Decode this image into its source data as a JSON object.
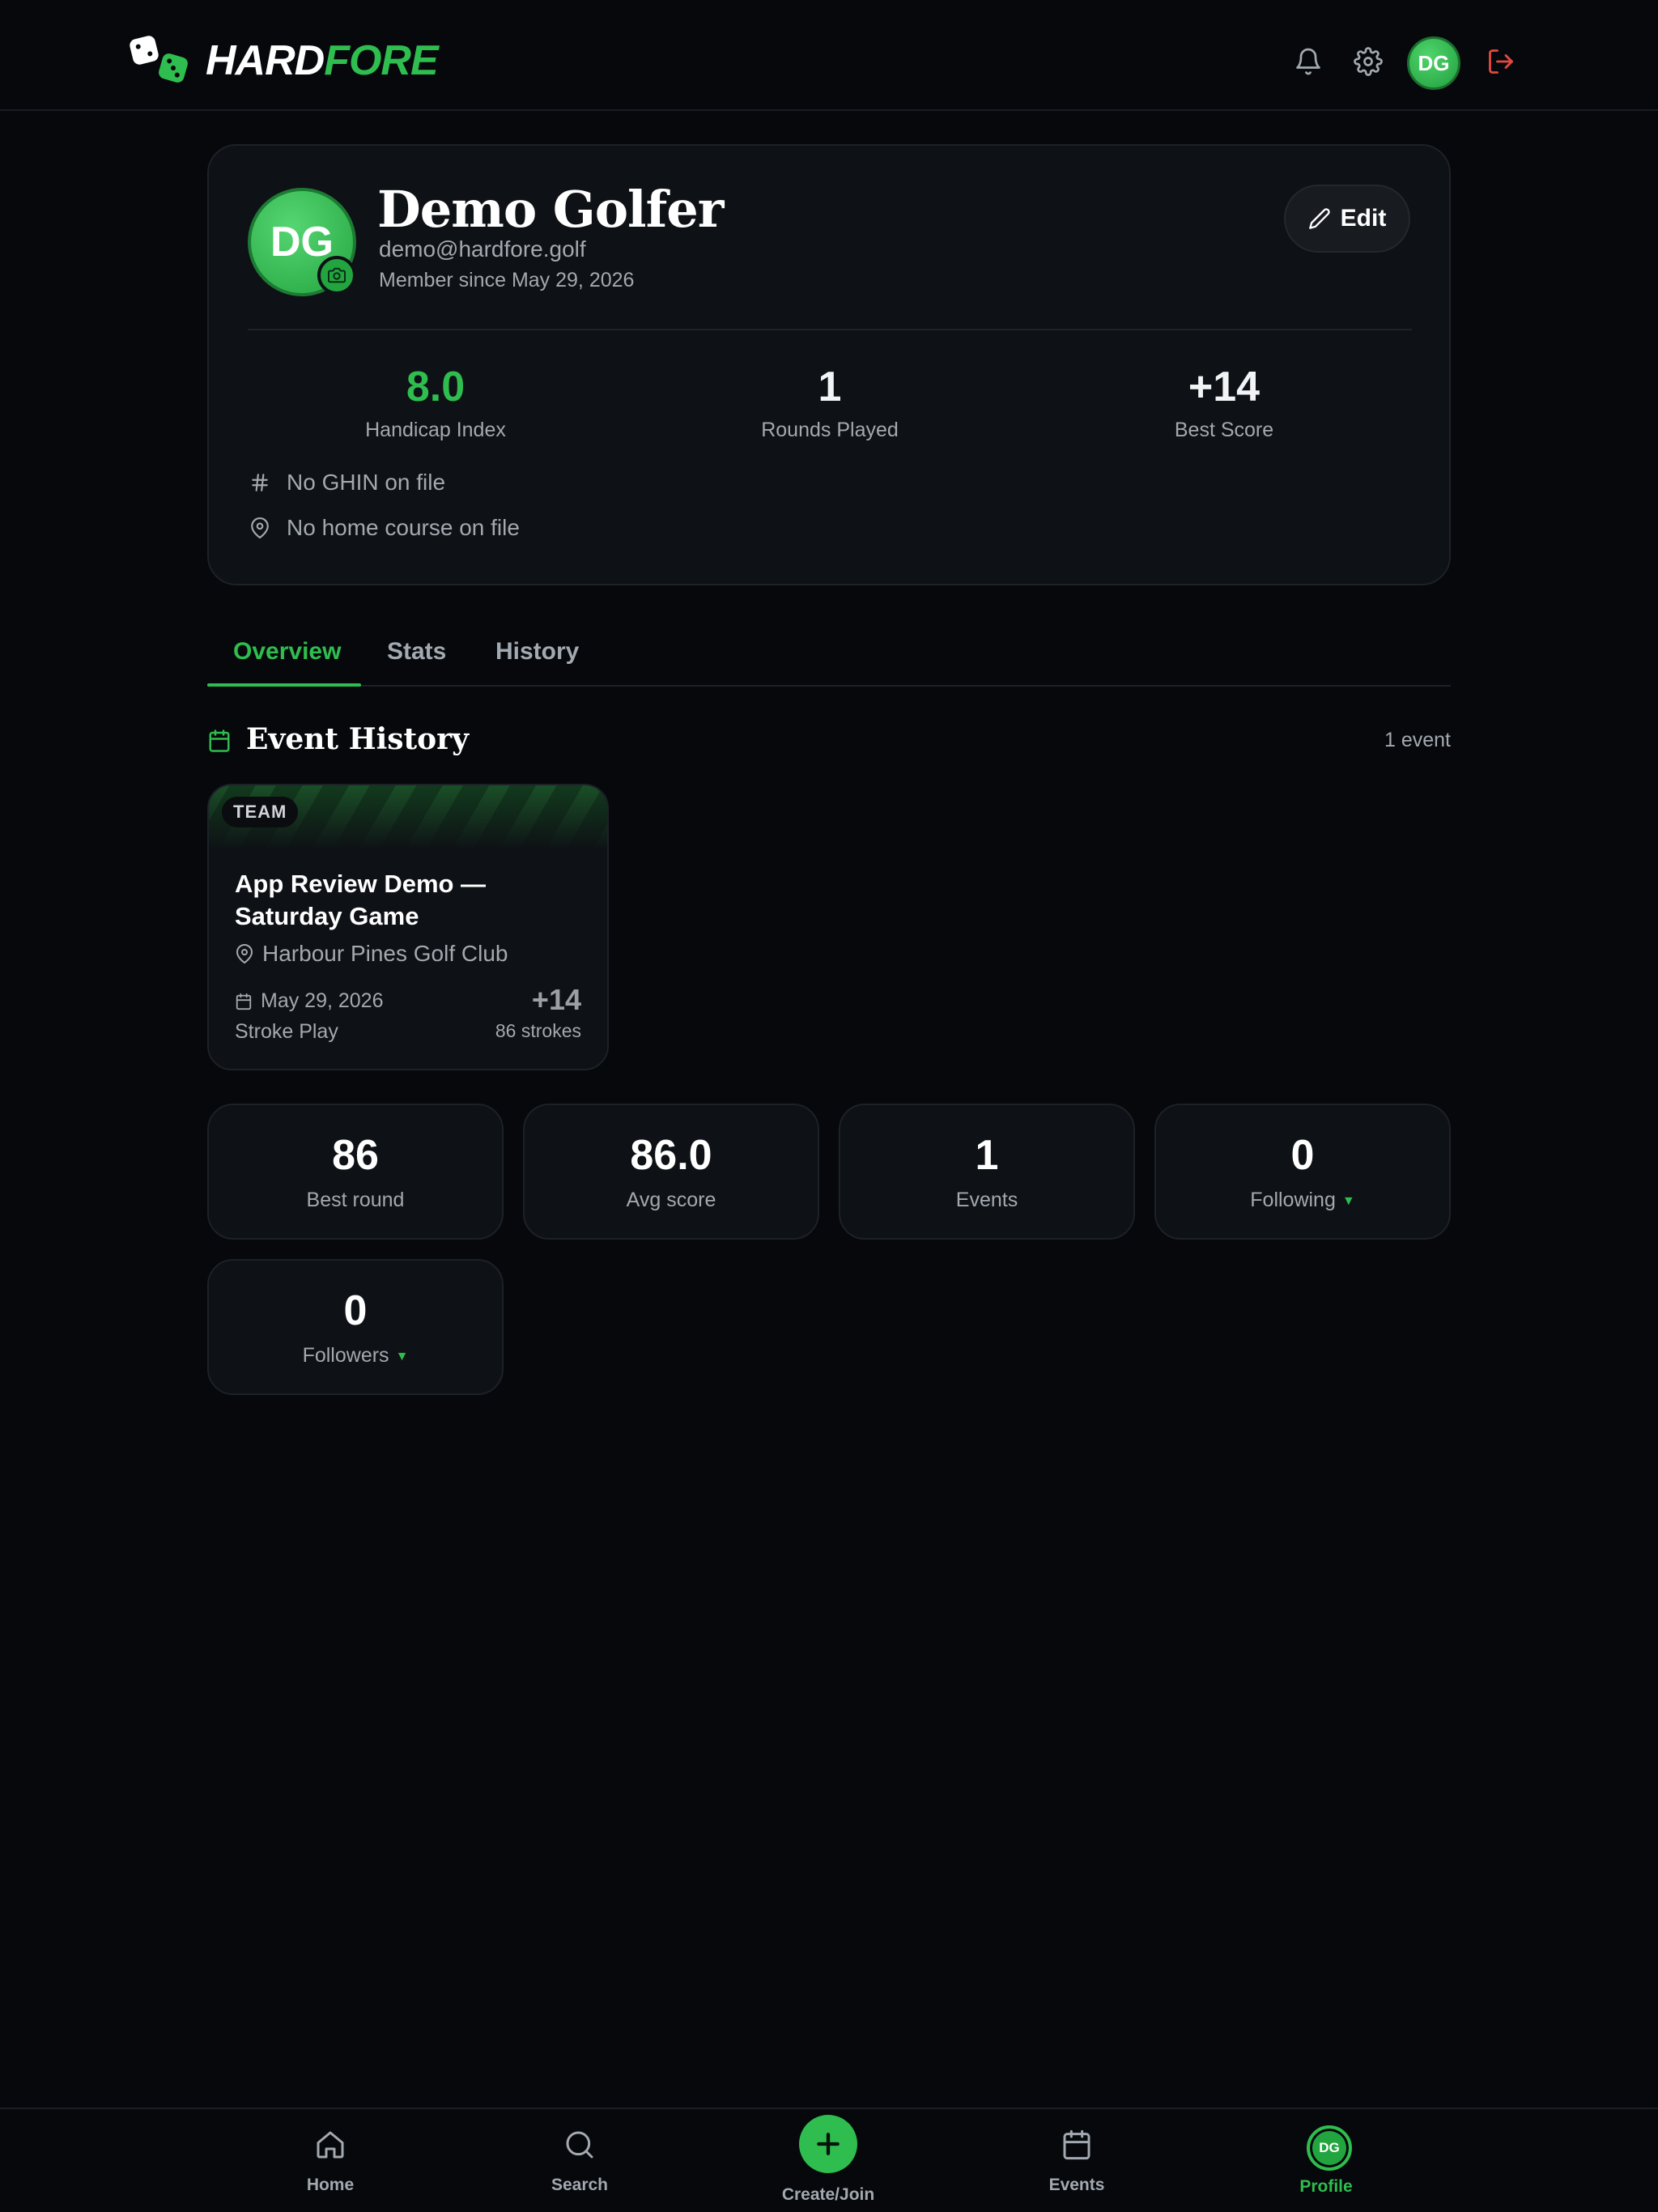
{
  "app": {
    "logo_part1": "HARD",
    "logo_part2": "FORE",
    "avatar_initials": "DG"
  },
  "colors": {
    "accent": "#2ebd4e",
    "background": "#06080c",
    "card": "#0e1115",
    "logout": "#e5483f"
  },
  "profile": {
    "initials": "DG",
    "name": "Demo Golfer",
    "email": "demo@hardfore.golf",
    "member_since": "Member since May 29, 2026",
    "edit_label": "Edit",
    "stats": [
      {
        "value": "8.0",
        "label": "Handicap Index"
      },
      {
        "value": "1",
        "label": "Rounds Played"
      },
      {
        "value": "+14",
        "label": "Best Score"
      }
    ],
    "ghin": "No GHIN on file",
    "home_course": "No home course on file"
  },
  "tabs": [
    {
      "label": "Overview"
    },
    {
      "label": "Stats"
    },
    {
      "label": "History"
    }
  ],
  "event_history": {
    "title": "Event History",
    "count": "1 event",
    "events": [
      {
        "badge": "TEAM",
        "title": "App Review Demo — Saturday Game",
        "course": "Harbour Pines Golf Club",
        "date": "May 29, 2026",
        "format": "Stroke Play",
        "score": "+14",
        "strokes": "86 strokes"
      }
    ]
  },
  "summary": [
    {
      "value": "86",
      "label": "Best round"
    },
    {
      "value": "86.0",
      "label": "Avg score"
    },
    {
      "value": "1",
      "label": "Events"
    },
    {
      "value": "0",
      "label": "Following"
    },
    {
      "value": "0",
      "label": "Followers"
    }
  ],
  "bottom_nav": {
    "items": [
      {
        "label": "Home",
        "icon": "home-icon"
      },
      {
        "label": "Search",
        "icon": "search-icon"
      },
      {
        "label": "Create/Join",
        "icon": "plus-icon"
      },
      {
        "label": "Events",
        "icon": "calendar-icon"
      },
      {
        "label": "Profile",
        "icon": "avatar"
      }
    ],
    "profile_initials": "DG"
  }
}
